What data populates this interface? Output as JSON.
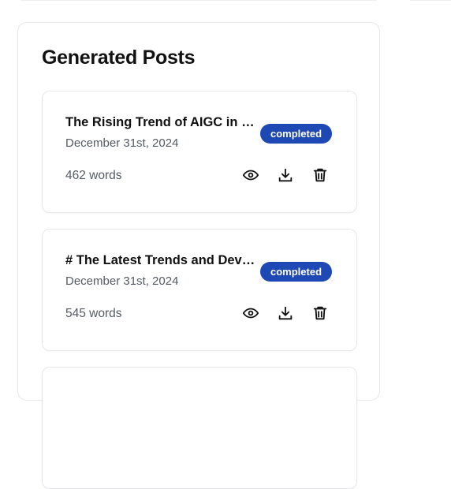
{
  "panel": {
    "title": "Generated Posts"
  },
  "posts": [
    {
      "title": "The Rising Trend of AIGC in Content Creation",
      "date": "December 31st, 2024",
      "status": "completed",
      "word_count": "462 words"
    },
    {
      "title": "# The Latest Trends and Developments",
      "date": "December 31st, 2024",
      "status": "completed",
      "word_count": "545 words"
    }
  ],
  "icons": {
    "view": "eye-icon",
    "download": "download-icon",
    "delete": "trash-icon"
  },
  "colors": {
    "badge": "#1e48b3",
    "badge_text": "#ffffff"
  }
}
